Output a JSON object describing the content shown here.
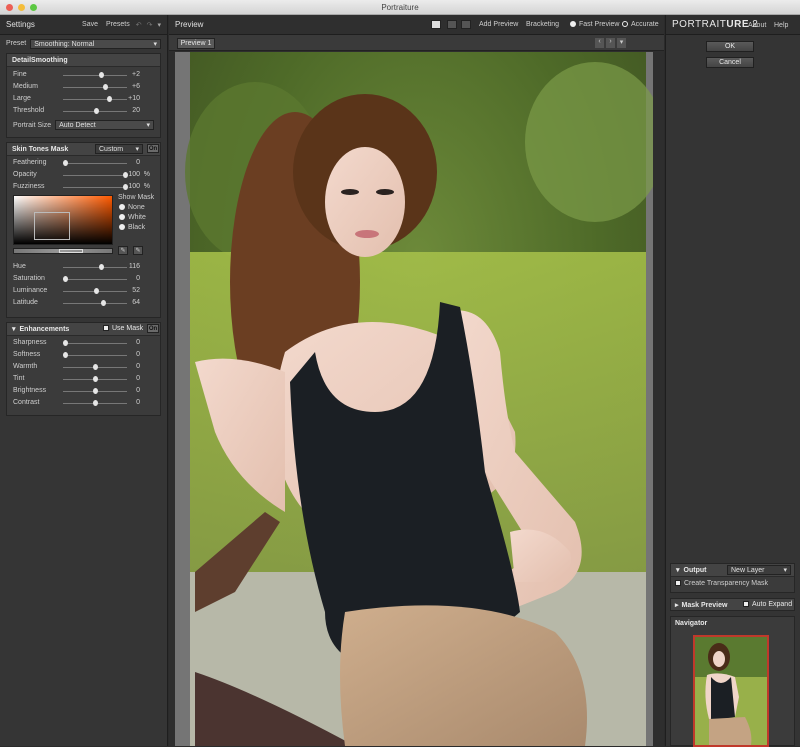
{
  "window": {
    "title": "Portraiture"
  },
  "settings": {
    "title": "Settings",
    "save": "Save",
    "presets": "Presets",
    "preset_label": "Preset",
    "preset_value": "Smoothing: Normal"
  },
  "detail": {
    "title": "DetailSmoothing",
    "sliders": [
      {
        "label": "Fine",
        "value": "+2",
        "pos": 0.6
      },
      {
        "label": "Medium",
        "value": "+6",
        "pos": 0.66
      },
      {
        "label": "Large",
        "value": "+10",
        "pos": 0.74
      },
      {
        "label": "Threshold",
        "value": "20",
        "pos": 0.52
      }
    ],
    "portrait_size_label": "Portrait Size",
    "portrait_size_value": "Auto Detect"
  },
  "skin": {
    "title": "Skin Tones Mask",
    "mode": "Custom",
    "on": "On",
    "sliders_top": [
      {
        "label": "Feathering",
        "value": "0",
        "unit": "",
        "pos": 0
      },
      {
        "label": "Opacity",
        "value": "100",
        "unit": "%",
        "pos": 1
      },
      {
        "label": "Fuzziness",
        "value": "100",
        "unit": "%",
        "pos": 1
      }
    ],
    "show_mask": "Show Mask",
    "options": [
      "None",
      "White",
      "Black"
    ],
    "sliders_bottom": [
      {
        "label": "Hue",
        "value": "116",
        "unit": "",
        "pos": 0.6
      },
      {
        "label": "Saturation",
        "value": "0",
        "unit": "",
        "pos": 0
      },
      {
        "label": "Luminance",
        "value": "52",
        "unit": "",
        "pos": 0.52
      },
      {
        "label": "Latitude",
        "value": "64",
        "unit": "",
        "pos": 0.64
      }
    ]
  },
  "enh": {
    "title": "Enhancements",
    "use_mask": "Use Mask",
    "on": "On",
    "sliders": [
      {
        "label": "Sharpness",
        "value": "0",
        "pos": 0
      },
      {
        "label": "Softness",
        "value": "0",
        "pos": 0
      },
      {
        "label": "Warmth",
        "value": "0",
        "pos": 0.5
      },
      {
        "label": "Tint",
        "value": "0",
        "pos": 0.5
      },
      {
        "label": "Brightness",
        "value": "0",
        "pos": 0.5
      },
      {
        "label": "Contrast",
        "value": "0",
        "pos": 0.5
      }
    ]
  },
  "preview": {
    "title": "Preview",
    "add_preview": "Add Preview",
    "bracketing": "Bracketing",
    "fast": "Fast Preview",
    "accurate": "Accurate",
    "tab": "Preview 1"
  },
  "right": {
    "logo_a": "PORTRAIT",
    "logo_b": "URE",
    "logo_c": "2",
    "about": "About",
    "help": "Help",
    "ok": "OK",
    "cancel": "Cancel",
    "output": "Output",
    "new_layer": "New Layer",
    "transparency": "Create Transparency Mask",
    "mask_preview": "Mask Preview",
    "auto_expand": "Auto Expand",
    "navigator": "Navigator"
  },
  "colors": {
    "accent": "#c0392b",
    "panel": "#353535"
  }
}
